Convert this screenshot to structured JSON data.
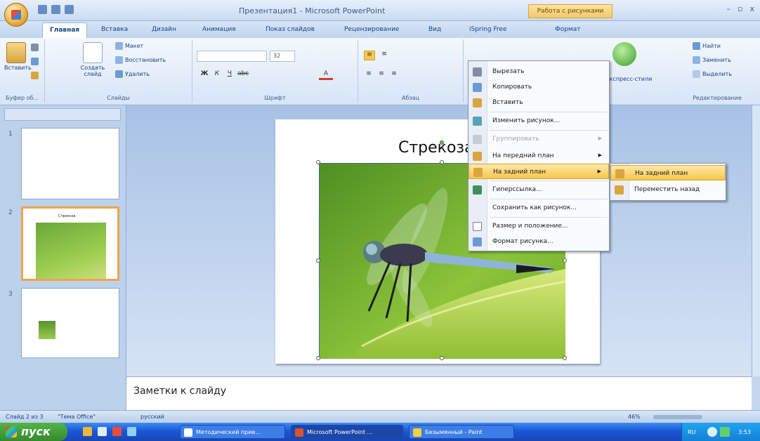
{
  "window": {
    "title": "Презентация1 - Microsoft PowerPoint",
    "context_tab": "Работа с рисунками",
    "controls": [
      "–",
      "▫",
      "x"
    ]
  },
  "tabs": [
    {
      "label": "Главная",
      "active": true
    },
    {
      "label": "Вставка"
    },
    {
      "label": "Дизайн"
    },
    {
      "label": "Анимация"
    },
    {
      "label": "Показ слайдов"
    },
    {
      "label": "Рецензирование"
    },
    {
      "label": "Вид"
    },
    {
      "label": "iSpring Free"
    },
    {
      "label": "Формат"
    }
  ],
  "ribbon": {
    "clipboard": {
      "paste": "Вставить",
      "label": "Буфер об..."
    },
    "slides": {
      "new_slide": "Создать слайд",
      "layout": "Макет",
      "reset": "Восстановить",
      "delete": "Удалить",
      "label": "Слайды"
    },
    "font": {
      "size": "32",
      "label": "Шрифт"
    },
    "paragraph": {
      "label": "Абзац"
    },
    "drawing": {
      "quick_styles": "Экспресс-стили"
    },
    "editing": {
      "find": "Найти",
      "replace": "Заменить",
      "select": "Выделить",
      "label": "Редактирование"
    }
  },
  "slides_panel": {
    "numbers": [
      "1",
      "2",
      "3"
    ],
    "thumb2_title": "Стрекоза"
  },
  "slide": {
    "title": "Стрекоза"
  },
  "notes": {
    "placeholder": "Заметки к слайду"
  },
  "status": {
    "slide_info": "Слайд 2 из 3",
    "theme": "\"Тема Office\"",
    "language": "русский",
    "zoom": "46%"
  },
  "context_menu": {
    "items": [
      {
        "label": "Вырезать",
        "icon": "scissors-icon"
      },
      {
        "label": "Копировать",
        "icon": "copy-icon"
      },
      {
        "label": "Вставить",
        "icon": "paste-icon"
      },
      {
        "label": "Изменить рисунок...",
        "icon": "change-picture-icon"
      },
      {
        "label": "Группировать",
        "icon": "group-icon",
        "disabled": true
      },
      {
        "label": "На передний план",
        "icon": "bring-front-icon"
      },
      {
        "label": "На задний план",
        "icon": "send-back-icon",
        "highlighted": true
      },
      {
        "label": "Гиперссылка...",
        "icon": "hyperlink-icon"
      },
      {
        "label": "Сохранить как рисунок...",
        "icon": ""
      },
      {
        "label": "Размер и положение...",
        "icon": "size-icon"
      },
      {
        "label": "Формат рисунка...",
        "icon": "format-picture-icon"
      }
    ],
    "submenu": [
      {
        "label": "На задний план",
        "highlighted": true
      },
      {
        "label": "Переместить назад"
      }
    ]
  },
  "taskbar": {
    "start": "пуск",
    "items": [
      "Методический прие...",
      "Microsoft PowerPoint ...",
      "Безымянный - Paint"
    ],
    "lang": "RU",
    "time": "3:53"
  }
}
